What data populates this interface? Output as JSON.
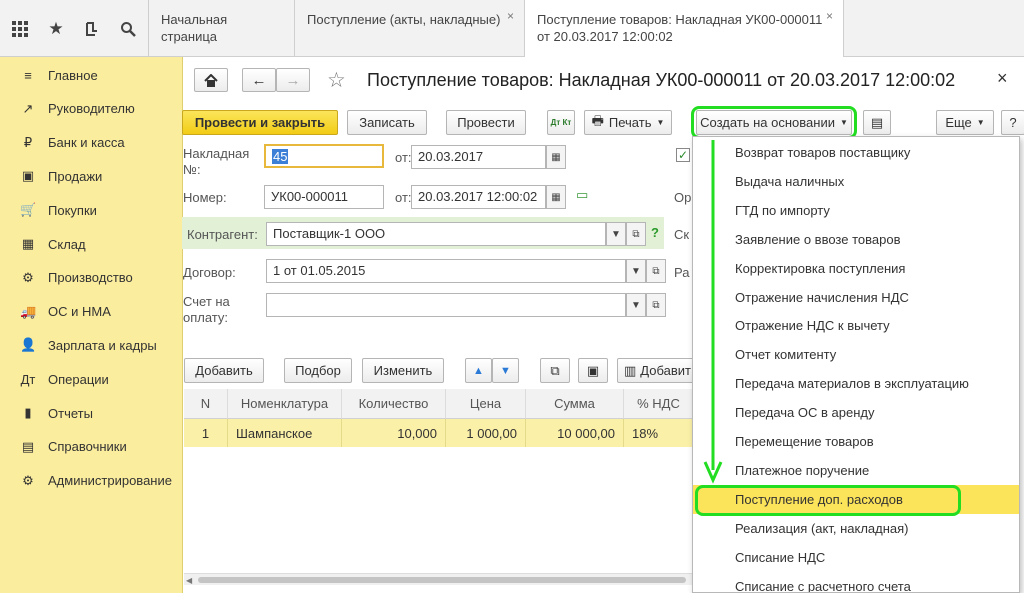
{
  "tabs": [
    {
      "label": "Начальная страница"
    },
    {
      "label": "Поступление (акты, накладные)",
      "close": "×"
    },
    {
      "label_line1": "Поступление товаров: Накладная УК00-000011",
      "label_line2": "от 20.03.2017 12:00:02",
      "close": "×"
    }
  ],
  "topbar_icons": [
    "apps-grid-icon",
    "star-icon",
    "history-icon",
    "search-icon"
  ],
  "sidebar": {
    "items": [
      {
        "label": "Главное",
        "icon": "≡"
      },
      {
        "label": "Руководителю",
        "icon": "↗"
      },
      {
        "label": "Банк и касса",
        "icon": "₽"
      },
      {
        "label": "Продажи",
        "icon": "▣"
      },
      {
        "label": "Покупки",
        "icon": "🛒"
      },
      {
        "label": "Склад",
        "icon": "▦"
      },
      {
        "label": "Производство",
        "icon": "⚙"
      },
      {
        "label": "ОС и НМА",
        "icon": "🚚"
      },
      {
        "label": "Зарплата и кадры",
        "icon": "👤"
      },
      {
        "label": "Операции",
        "icon": "Дт"
      },
      {
        "label": "Отчеты",
        "icon": "▮"
      },
      {
        "label": "Справочники",
        "icon": "▤"
      },
      {
        "label": "Администрирование",
        "icon": "⚙"
      }
    ]
  },
  "document": {
    "title": "Поступление товаров: Накладная УК00-000011 от 20.03.2017 12:00:02",
    "close": "×"
  },
  "toolbar": {
    "post_close": "Провести и закрыть",
    "save": "Записать",
    "post": "Провести",
    "dtkt": "Дт Кт",
    "print": "Печать",
    "create_based": "Создать на основании",
    "more": "Еще",
    "help": "?"
  },
  "form": {
    "invoice_label": "Накладная №:",
    "invoice_value": "45",
    "from_label": "от:",
    "invoice_date": "20.03.2017",
    "number_label": "Номер:",
    "number_value": "УК00-000011",
    "number_date": "20.03.2017 12:00:02",
    "contractor_label": "Контрагент:",
    "contractor_value": "Поставщик-1 ООО",
    "contract_label": "Договор:",
    "contract_value": "1 от 01.05.2015",
    "bill_label_line1": "Счет на",
    "bill_label_line2": "оплату:",
    "bill_value": "",
    "right_labels": [
      "Ор",
      "Ск",
      "Ра"
    ]
  },
  "table_toolbar": {
    "add": "Добавить",
    "pick": "Подбор",
    "change": "Изменить",
    "add2": "Добавит"
  },
  "table": {
    "columns": [
      "N",
      "Номенклатура",
      "Количество",
      "Цена",
      "Сумма",
      "% НДС"
    ],
    "rows": [
      [
        "1",
        "Шампанское",
        "10,000",
        "1 000,00",
        "10 000,00",
        "18%"
      ]
    ]
  },
  "dropdown": {
    "items": [
      "Возврат товаров поставщику",
      "Выдача наличных",
      "ГТД по импорту",
      "Заявление о ввозе товаров",
      "Корректировка поступления",
      "Отражение начисления НДС",
      "Отражение НДС к вычету",
      "Отчет комитенту",
      "Передача материалов в эксплуатацию",
      "Передача ОС в аренду",
      "Перемещение товаров",
      "Платежное поручение",
      "Поступление доп. расходов",
      "Реализация (акт, накладная)",
      "Списание НДС",
      "Списание с расчетного счета"
    ],
    "highlighted_index": 12
  },
  "colors": {
    "sidebar_bg": "#fbed9e",
    "primary_button": "#f2cc15",
    "highlight": "#fbe35a",
    "annotation_green": "#22dd22",
    "row_bg": "#fbf0a8"
  }
}
